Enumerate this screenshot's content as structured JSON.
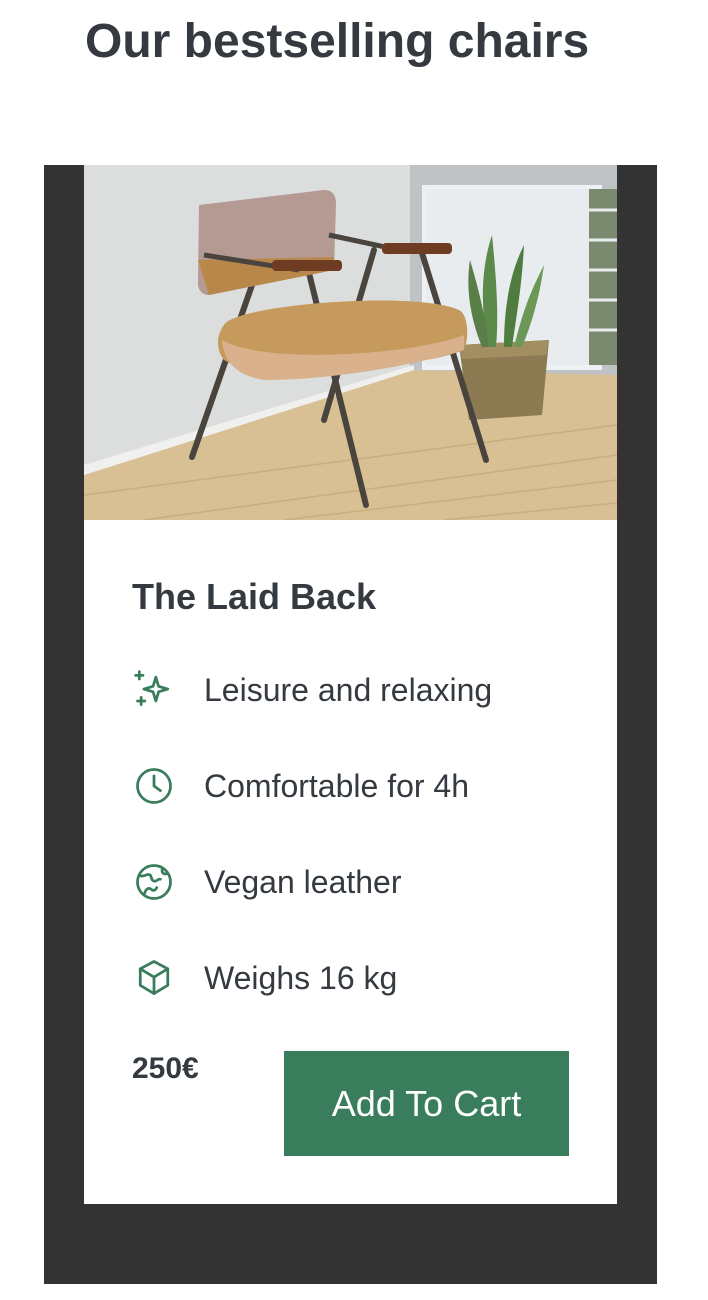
{
  "page": {
    "title": "Our bestselling chairs"
  },
  "product": {
    "name": "The Laid Back",
    "features": [
      {
        "icon": "sparkles-icon",
        "label": "Leisure and relaxing"
      },
      {
        "icon": "clock-icon",
        "label": "Comfortable for 4h"
      },
      {
        "icon": "globe-icon",
        "label": "Vegan leather"
      },
      {
        "icon": "cube-icon",
        "label": "Weighs 16 kg"
      }
    ],
    "price": "250€",
    "add_to_cart_label": "Add To Cart"
  },
  "colors": {
    "accent": "#3a7d5c",
    "text": "#343a40",
    "panel": "#333333"
  }
}
